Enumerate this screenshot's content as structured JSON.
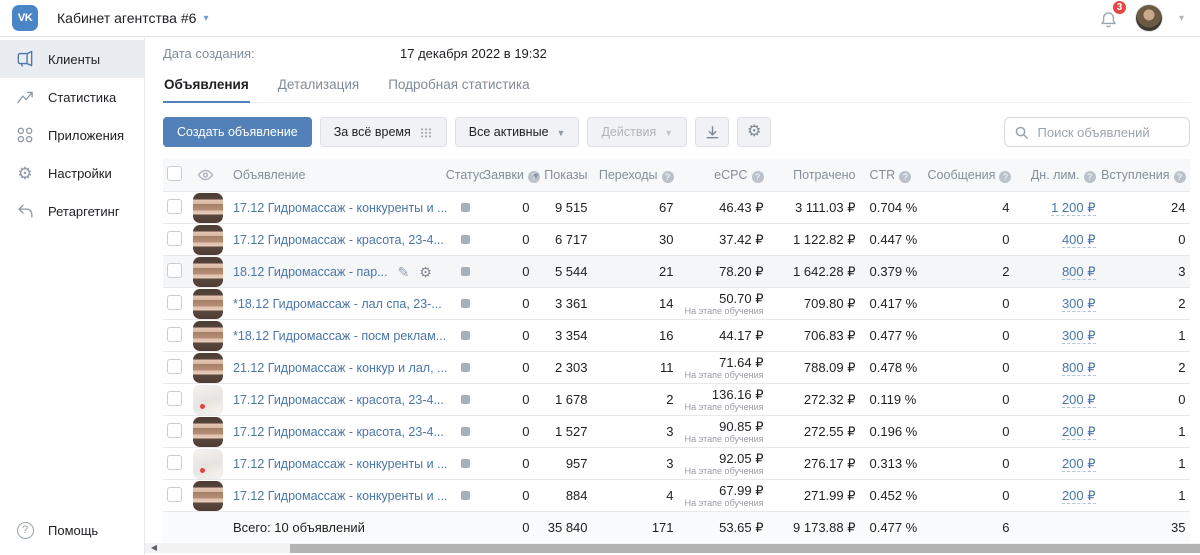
{
  "colors": {
    "accent": "#5181b8",
    "link": "#4a76a8",
    "badge": "#e64646",
    "active_item_bg": "#e9edf1"
  },
  "topbar": {
    "title": "Кабинет агентства #6",
    "notification_count": "3"
  },
  "sidebar": {
    "items": [
      {
        "label": "Клиенты",
        "icon": "megaphone-icon",
        "active": true
      },
      {
        "label": "Статистика",
        "icon": "stats-icon",
        "active": false
      },
      {
        "label": "Приложения",
        "icon": "apps-icon",
        "active": false
      },
      {
        "label": "Настройки",
        "icon": "gear-icon",
        "active": false
      },
      {
        "label": "Ретаргетинг",
        "icon": "retargeting-icon",
        "active": false
      }
    ],
    "help_label": "Помощь"
  },
  "meta": {
    "label": "Дата создания:",
    "value": "17 декабря 2022 в 19:32"
  },
  "tabs": [
    {
      "label": "Объявления",
      "active": true
    },
    {
      "label": "Детализация",
      "active": false
    },
    {
      "label": "Подробная статистика",
      "active": false
    }
  ],
  "toolbar": {
    "create_label": "Создать объявление",
    "period_label": "За всё время",
    "filter_label": "Все активные",
    "actions_label": "Действия",
    "download_icon": "download-icon",
    "settings_icon": "gear-icon"
  },
  "search": {
    "placeholder": "Поиск объявлений"
  },
  "table": {
    "headers": {
      "ad": "Объявление",
      "status": "Статус",
      "zayavki": "Заявки",
      "pokazy": "Показы",
      "perehody": "Переходы",
      "ecpc": "eCPC",
      "potracheno": "Потрачено",
      "ctr": "CTR",
      "soobshcheniya": "Сообщения",
      "dn_lim": "Дн. лим.",
      "vstupleniya": "Вступления"
    },
    "rows": [
      {
        "title": "17.12 Гидромассаж - конкуренты и ...",
        "thumb": "dark",
        "status": "stopped",
        "zayavki": "0",
        "pokazy": "9 515",
        "perehody": "67",
        "ecpc": "46.43 ₽",
        "ecpc_note": "",
        "potracheno": "3 111.03 ₽",
        "ctr": "0.704 %",
        "soobshcheniya": "4",
        "dn_lim": "1 200 ₽",
        "vstupleniya": "24",
        "has_actions": false,
        "hover": false
      },
      {
        "title": "17.12 Гидромассаж - красота, 23-4...",
        "thumb": "dark",
        "status": "stopped",
        "zayavki": "0",
        "pokazy": "6 717",
        "perehody": "30",
        "ecpc": "37.42 ₽",
        "ecpc_note": "",
        "potracheno": "1 122.82 ₽",
        "ctr": "0.447 %",
        "soobshcheniya": "0",
        "dn_lim": "400 ₽",
        "vstupleniya": "0",
        "has_actions": false,
        "hover": false
      },
      {
        "title": "18.12 Гидромассаж - пар...",
        "thumb": "dark",
        "status": "stopped",
        "zayavki": "0",
        "pokazy": "5 544",
        "perehody": "21",
        "ecpc": "78.20 ₽",
        "ecpc_note": "",
        "potracheno": "1 642.28 ₽",
        "ctr": "0.379 %",
        "soobshcheniya": "2",
        "dn_lim": "800 ₽",
        "vstupleniya": "3",
        "has_actions": true,
        "hover": true
      },
      {
        "title": "*18.12 Гидромассаж - лал спа, 23-...",
        "thumb": "dark",
        "status": "stopped",
        "zayavki": "0",
        "pokazy": "3 361",
        "perehody": "14",
        "ecpc": "50.70 ₽",
        "ecpc_note": "На этапе обучения",
        "potracheno": "709.80 ₽",
        "ctr": "0.417 %",
        "soobshcheniya": "0",
        "dn_lim": "300 ₽",
        "vstupleniya": "2",
        "has_actions": false,
        "hover": false
      },
      {
        "title": "*18.12 Гидромассаж - посм реклам...",
        "thumb": "dark",
        "status": "stopped",
        "zayavki": "0",
        "pokazy": "3 354",
        "perehody": "16",
        "ecpc": "44.17 ₽",
        "ecpc_note": "",
        "potracheno": "706.83 ₽",
        "ctr": "0.477 %",
        "soobshcheniya": "0",
        "dn_lim": "300 ₽",
        "vstupleniya": "1",
        "has_actions": false,
        "hover": false
      },
      {
        "title": "21.12 Гидромассаж - конкур и лал, ...",
        "thumb": "dark",
        "status": "stopped",
        "zayavki": "0",
        "pokazy": "2 303",
        "perehody": "11",
        "ecpc": "71.64 ₽",
        "ecpc_note": "На этапе обучения",
        "potracheno": "788.09 ₽",
        "ctr": "0.478 %",
        "soobshcheniya": "0",
        "dn_lim": "800 ₽",
        "vstupleniya": "2",
        "has_actions": false,
        "hover": false
      },
      {
        "title": "17.12 Гидромассаж - красота, 23-4...",
        "thumb": "light",
        "status": "stopped",
        "zayavki": "0",
        "pokazy": "1 678",
        "perehody": "2",
        "ecpc": "136.16 ₽",
        "ecpc_note": "На этапе обучения",
        "potracheno": "272.32 ₽",
        "ctr": "0.119 %",
        "soobshcheniya": "0",
        "dn_lim": "200 ₽",
        "vstupleniya": "0",
        "has_actions": false,
        "hover": false
      },
      {
        "title": "17.12 Гидромассаж - красота, 23-4...",
        "thumb": "dark",
        "status": "stopped",
        "zayavki": "0",
        "pokazy": "1 527",
        "perehody": "3",
        "ecpc": "90.85 ₽",
        "ecpc_note": "На этапе обучения",
        "potracheno": "272.55 ₽",
        "ctr": "0.196 %",
        "soobshcheniya": "0",
        "dn_lim": "200 ₽",
        "vstupleniya": "1",
        "has_actions": false,
        "hover": false
      },
      {
        "title": "17.12 Гидромассаж - конкуренты и ...",
        "thumb": "light",
        "status": "stopped",
        "zayavki": "0",
        "pokazy": "957",
        "perehody": "3",
        "ecpc": "92.05 ₽",
        "ecpc_note": "На этапе обучения",
        "potracheno": "276.17 ₽",
        "ctr": "0.313 %",
        "soobshcheniya": "0",
        "dn_lim": "200 ₽",
        "vstupleniya": "1",
        "has_actions": false,
        "hover": false
      },
      {
        "title": "17.12 Гидромассаж - конкуренты и ...",
        "thumb": "dark",
        "status": "stopped",
        "zayavki": "0",
        "pokazy": "884",
        "perehody": "4",
        "ecpc": "67.99 ₽",
        "ecpc_note": "На этапе обучения",
        "potracheno": "271.99 ₽",
        "ctr": "0.452 %",
        "soobshcheniya": "0",
        "dn_lim": "200 ₽",
        "vstupleniya": "1",
        "has_actions": false,
        "hover": false
      }
    ],
    "totals": {
      "label": "Всего: 10 объявлений",
      "zayavki": "0",
      "pokazy": "35 840",
      "perehody": "171",
      "ecpc": "53.65 ₽",
      "potracheno": "9 173.88 ₽",
      "ctr": "0.477 %",
      "soobshcheniya": "6",
      "dn_lim": "",
      "vstupleniya": "35"
    }
  }
}
